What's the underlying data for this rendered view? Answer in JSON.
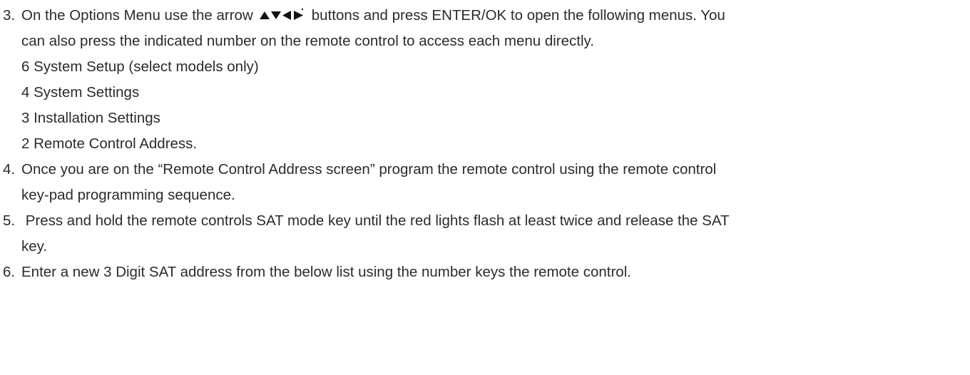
{
  "steps": [
    {
      "number": "3.",
      "line1_before": "On the Options Menu use the arrow",
      "arrow_icons": [
        "up-arrow-icon",
        "down-arrow-icon",
        "left-arrow-icon",
        "right-arrow-icon"
      ],
      "line1_after": "buttons and press ENTER/OK to open the following menus. You",
      "line2": "can also press the indicated number on the remote control to access each menu directly.",
      "menus": [
        "6 System Setup (select models only)",
        "4 System Settings",
        "3 Installation Settings",
        "2 Remote Control Address."
      ]
    },
    {
      "number": "4.",
      "line1": "Once you are on the “Remote Control Address screen” program the remote control using the remote control",
      "line2": "key-pad programming sequence."
    },
    {
      "number": "5.",
      "line1": " Press and hold the remote controls SAT mode key until the red lights flash at least twice and release the SAT",
      "line2": "key."
    },
    {
      "number": "6.",
      "line1": "Enter a new 3 Digit SAT address from the below list using the number keys the remote control."
    }
  ],
  "colors": {
    "text": "#2b2b2b",
    "icon": "#111111"
  }
}
